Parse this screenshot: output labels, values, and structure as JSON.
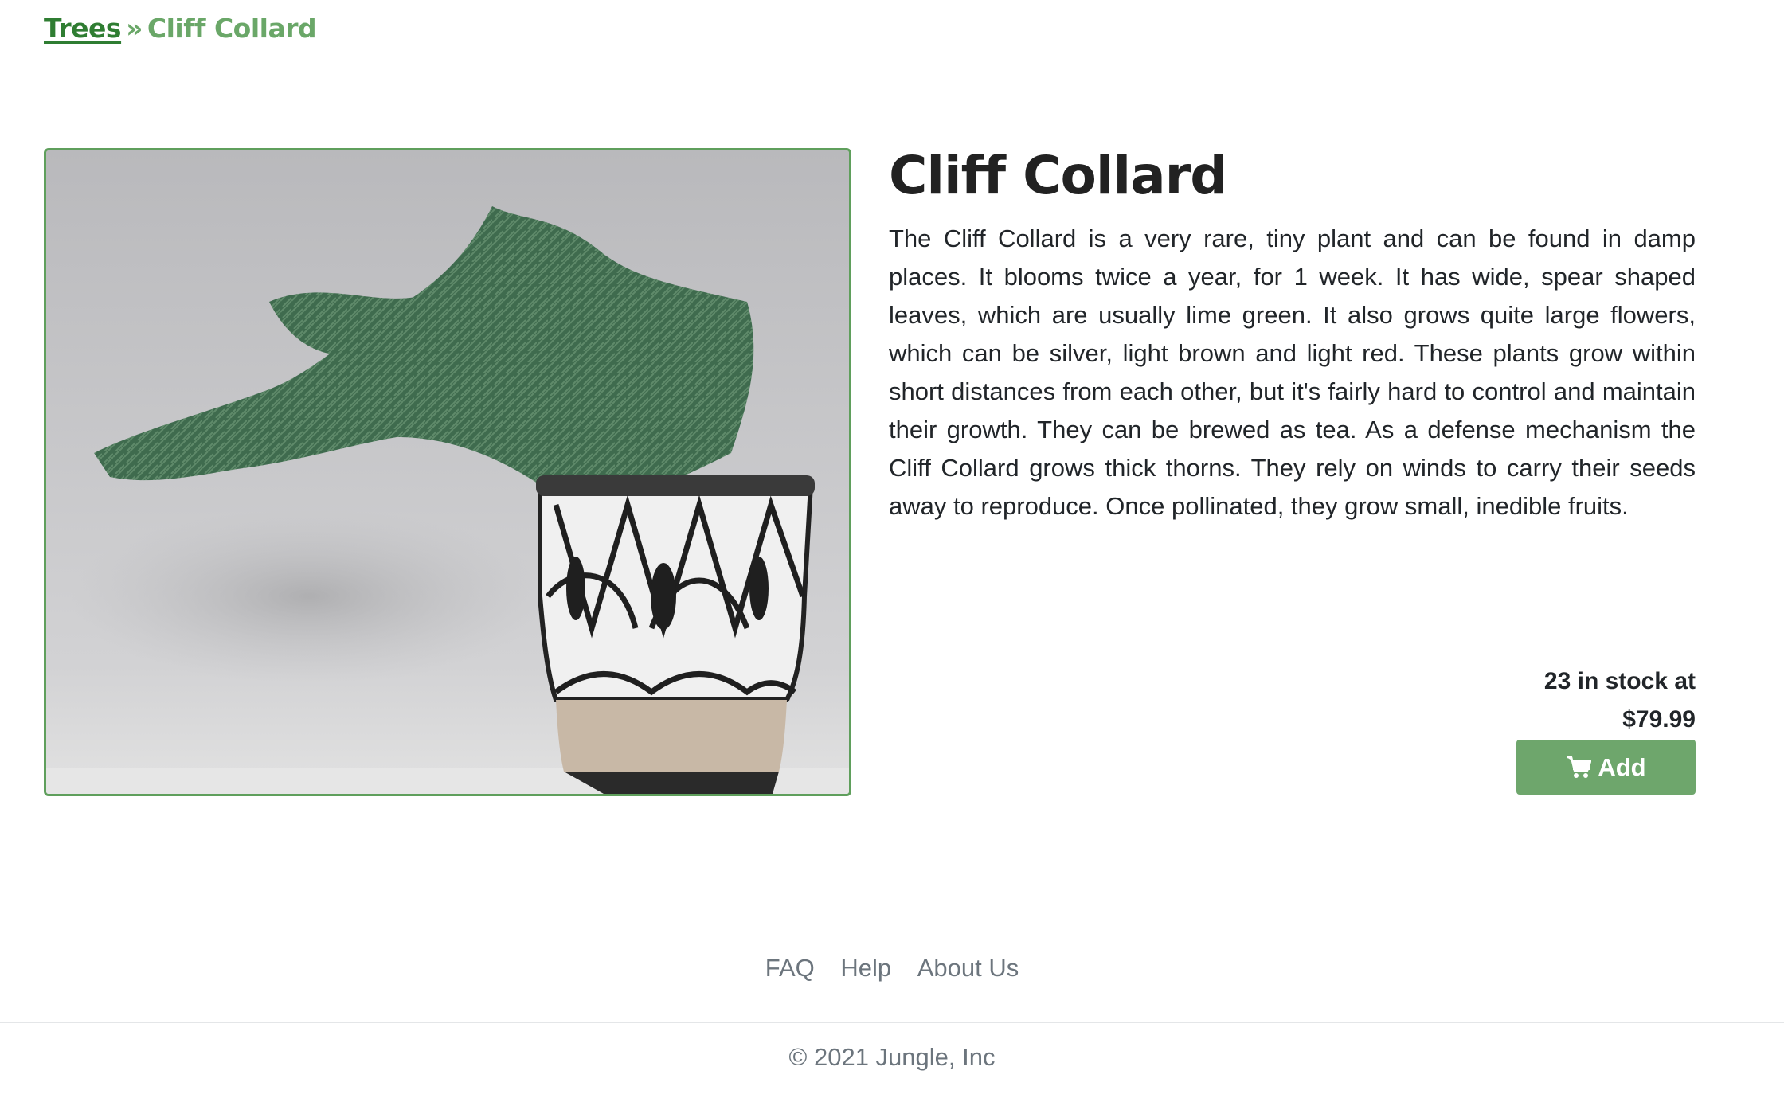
{
  "breadcrumb": {
    "parent": "Trees",
    "separator": "»",
    "current": "Cliff Collard"
  },
  "product": {
    "title": "Cliff Collard",
    "description": "The Cliff Collard is a very rare, tiny plant and can be found in damp places. It blooms twice a year, for 1 week. It has wide, spear shaped leaves, which are usually lime green. It also grows quite large flowers, which can be silver, light brown and light red. These plants grow within short distances from each other, but it's fairly hard to control and maintain their growth. They can be brewed as tea. As a defense mechanism the Cliff Collard grows thick thorns. They rely on winds to carry their seeds away to reproduce. Once pollinated, they grow small, inedible fruits.",
    "stock_text": "23 in stock at",
    "price": "$79.99",
    "add_label": "Add",
    "add_icon": "shopping-cart-icon"
  },
  "footer": {
    "links": [
      "FAQ",
      "Help",
      "About Us"
    ],
    "copyright": "© 2021 Jungle, Inc"
  },
  "colors": {
    "accent": "#6ea66c",
    "link": "#2f7d32",
    "muted": "#6c757d"
  }
}
